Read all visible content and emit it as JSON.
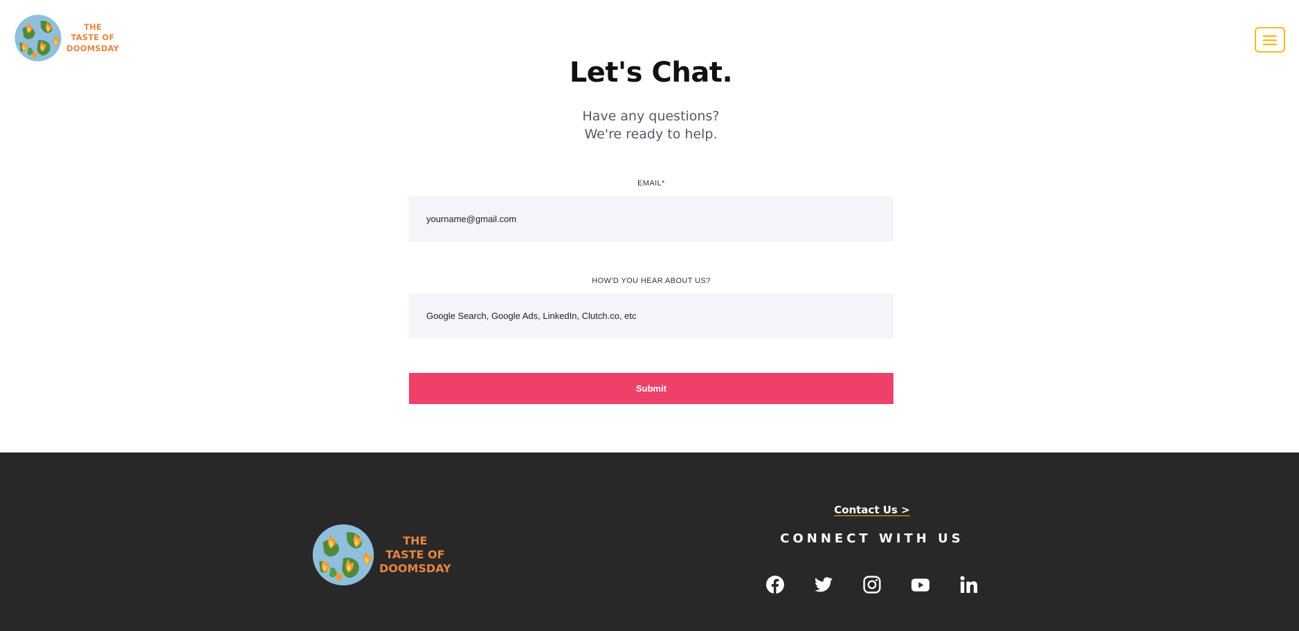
{
  "header": {
    "logo_lines": [
      "THE",
      "TASTE OF",
      "DOOMSDAY"
    ],
    "menu_icon": "hamburger-menu-icon"
  },
  "main": {
    "title": "Let's Chat.",
    "subtitle_line1": "Have any questions?",
    "subtitle_line2": "We're ready to help.",
    "email": {
      "label": "EMAIL*",
      "placeholder": "yourname@gmail.com"
    },
    "source": {
      "label": "HOW'D YOU HEAR ABOUT US?",
      "placeholder": "Google Search, Google Ads, LinkedIn, Clutch.co, etc"
    },
    "submit_label": "Submit"
  },
  "footer": {
    "logo_lines": [
      "THE",
      "TASTE OF",
      "DOOMSDAY"
    ],
    "contact_link": "Contact Us >",
    "connect_heading": "CONNECT WITH US",
    "social_icons": [
      "facebook-icon",
      "twitter-icon",
      "instagram-icon",
      "youtube-icon",
      "linkedin-icon"
    ]
  },
  "colors": {
    "accent_yellow": "#f2bd1d",
    "logo_orange": "#e8853c",
    "submit_pink": "#ee4068",
    "footer_bg": "#282828",
    "field_bg": "#f4f5f8"
  }
}
